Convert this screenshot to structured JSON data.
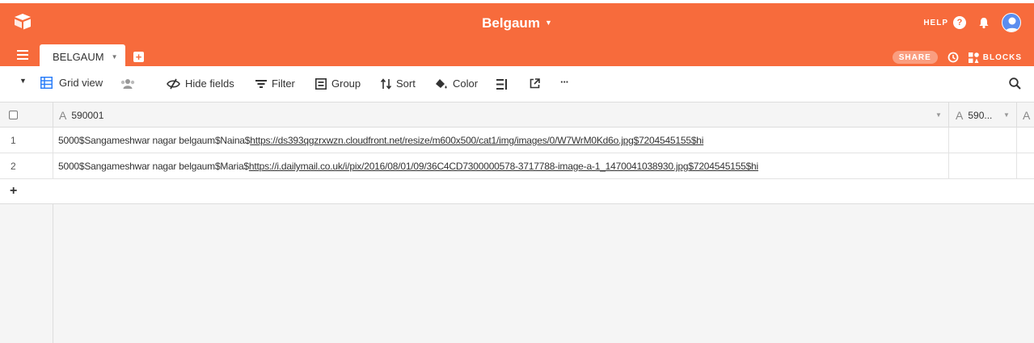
{
  "header": {
    "base_name": "Belgaum",
    "help_label": "HELP",
    "help_glyph": "?",
    "share_label": "SHARE",
    "blocks_label": "BLOCKS",
    "brand_color": "#f76b3c"
  },
  "tabs": [
    {
      "label": "BELGAUM",
      "active": true
    }
  ],
  "toolbar": {
    "view_name": "Grid view",
    "hide_fields": "Hide fields",
    "filter": "Filter",
    "group": "Group",
    "sort": "Sort",
    "color": "Color",
    "more": "···"
  },
  "grid": {
    "columns": [
      {
        "type_icon": "A",
        "name": "590001"
      },
      {
        "type_icon": "A",
        "name": "590..."
      },
      {
        "type_icon": "A",
        "name": ""
      }
    ],
    "rows": [
      {
        "num": "1",
        "prefix": "5000$Sangameshwar nagar belgaum$Naina$",
        "link": "https://ds393qgzrxwzn.cloudfront.net/resize/m600x500/cat1/img/images/0/W7WrM0Kd6o.jpg$7204545155$hi"
      },
      {
        "num": "2",
        "prefix": "5000$Sangameshwar nagar belgaum$Maria$",
        "link": "https://i.dailymail.co.uk/i/pix/2016/08/01/09/36C4CD7300000578-3717788-image-a-1_1470041038930.jpg$7204545155$hi"
      }
    ],
    "add_row_glyph": "+"
  }
}
